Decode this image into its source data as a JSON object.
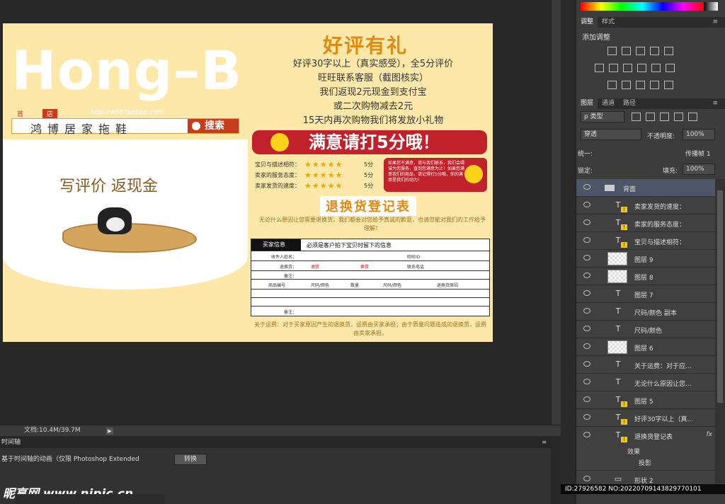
{
  "document": {
    "logo": "Hong–B",
    "tab_left": "首页",
    "tab_active": "店铺",
    "url": "http://whb.taobao.com",
    "shop_name": "鸿博居家拖鞋",
    "search_label": "搜索",
    "left_tagline": "写评价  返现金",
    "right_title": "好评有礼",
    "right_lines": [
      "好评30字以上（真实感受），全5分评价",
      "旺旺联系客服（截图核实）",
      "我们返现2元现金到支付宝",
      "或二次购物减去2元",
      "15天内再次购物我们将发放小礼物"
    ],
    "banner_text": "满意请打5分哦！",
    "ratings": [
      {
        "label": "宝贝与描述相符：",
        "stars": "★★★★★",
        "score": "5分"
      },
      {
        "label": "卖家的服务态度：",
        "stars": "★★★★★",
        "score": "5分"
      },
      {
        "label": "卖家发货的速度：",
        "stars": "★★★★★",
        "score": "5分"
      }
    ],
    "notice_text": "如果您不满意，请与我们联系，我们会竭诚为您服务，直到您满意为止！如果您满意我们的商品，请记得打5分哦，你的满意是我们的动力！",
    "return_title": "退换货登记表",
    "fine_note": "无论什么原因让您需要退换货，我们都会对您给予真诚的歉意，也请您能对我们的工作给予理解！",
    "form": {
      "header_label": "买家信息",
      "header_text": "必须是客户拍下宝贝时留下的信息",
      "fields": [
        "收件人姓名：",
        "退换货：",
        "备注："
      ],
      "right_fields": [
        "旺旺ID",
        "联系电话"
      ],
      "options": [
        "退货",
        "换货"
      ],
      "columns": [
        "商品编号",
        "尺码/颜色",
        "数量",
        "尺码/颜色",
        "退换货原因"
      ],
      "remark": "备注："
    },
    "bottom_note": "关于运费：对于买家原因产生的退换货，运费由买家承担；由于质量问题造成的退换货，运费由卖家承担。"
  },
  "status": {
    "doc_size": "文档:10.4M/39.7M"
  },
  "timeline": {
    "title": "时间轴",
    "message": "基于时间轴的动画（仅限 Photoshop Extended",
    "convert_label": "转换",
    "watermark": "昵享网 www.nipic.cn"
  },
  "adjust_panel": {
    "tabs": [
      "调整",
      "样式"
    ],
    "add_label": "添加调整"
  },
  "layers_panel": {
    "tabs": [
      "图层",
      "通道",
      "路径"
    ],
    "filter_label": "ρ 类型",
    "blend_mode": "穿透",
    "opacity_label": "不透明度:",
    "opacity_value": "100%",
    "unify_label": "统一:",
    "propagate_label": "传播帧 1",
    "lock_label": "锁定:",
    "fill_label": "填充:",
    "fill_value": "100%",
    "layers": [
      {
        "name": "背面",
        "type": "group"
      },
      {
        "name": "卖家发货的速度：",
        "type": "text-warn"
      },
      {
        "name": "卖家的服务态度：",
        "type": "text-warn"
      },
      {
        "name": "宝贝与描述相符：",
        "type": "text-warn"
      },
      {
        "name": "图层 9",
        "type": "raster"
      },
      {
        "name": "图层 8",
        "type": "raster"
      },
      {
        "name": "图层 7",
        "type": "text"
      },
      {
        "name": "尺码/颜色 副本",
        "type": "text"
      },
      {
        "name": "尺码/颜色",
        "type": "text"
      },
      {
        "name": "图层 6",
        "type": "raster"
      },
      {
        "name": "关于运费：对于应...",
        "type": "text"
      },
      {
        "name": "无论什么原因让您...",
        "type": "text"
      },
      {
        "name": "图层 5",
        "type": "text-warn"
      },
      {
        "name": "好评30字以上（真...",
        "type": "text-warn"
      },
      {
        "name": "退换货登记表",
        "type": "text-warn",
        "fx": "fx"
      },
      {
        "name": "形状 2",
        "type": "shape"
      }
    ],
    "effects_label": "效果",
    "drop_shadow_label": "投影"
  },
  "footer_id": "ID:27926582 NO:20220709143829770101"
}
